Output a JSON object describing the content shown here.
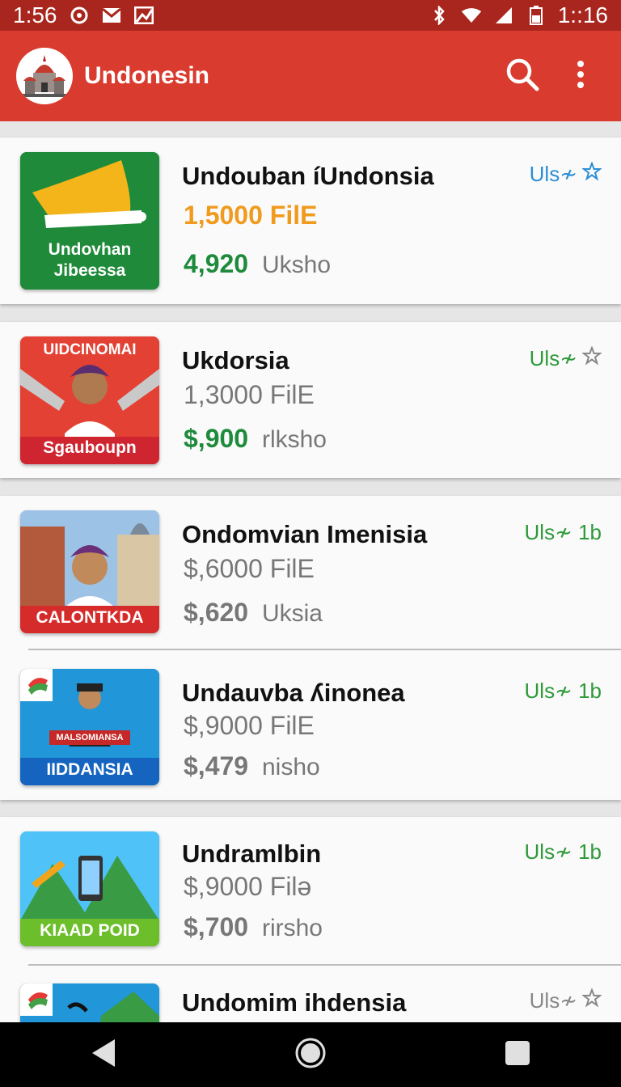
{
  "status_bar": {
    "time_left": "1:56",
    "time_right": "1::16"
  },
  "app_bar": {
    "title": "Undonesin"
  },
  "items": [
    {
      "name": "Undouban íUndonsia",
      "size": "1,5000 FilE",
      "price": "4,920",
      "price_note": "Uksho",
      "badge": "Uls≁",
      "thumb_label": "Undovhan Jibeessa",
      "accent": "#f09a1e"
    },
    {
      "name": "Ukdorsia",
      "size": "1,3000 FilE",
      "price": "$,900",
      "price_note": "rlksho",
      "badge": "Uls≁",
      "thumb_label": "Sgaubоupn",
      "thumb_top": "UIDCINOMAI"
    },
    {
      "name": "Ondomvian Imenisia",
      "size": "$,6000 FilE",
      "price": "$,620",
      "price_note": "Uksia",
      "badge": "Uls≁ 1b",
      "thumb_label": "CALONTKDA"
    },
    {
      "name": "Undauvba ʎinonea",
      "size": "$,9000 FilE",
      "price": "$,479",
      "price_note": "nisho",
      "badge": "Uls≁ 1b",
      "thumb_label": "IIDDANSIA",
      "thumb_ribbon": "MALSOMIANSA"
    },
    {
      "name": "Undramlbin",
      "size": "$,9000 Filə",
      "price": "$,700",
      "price_note": "rirsho",
      "badge": "Uls≁ 1b",
      "thumb_label": "KIAAD POID"
    },
    {
      "name": "Undomim ihdensia",
      "badge": "Uls≁"
    }
  ]
}
